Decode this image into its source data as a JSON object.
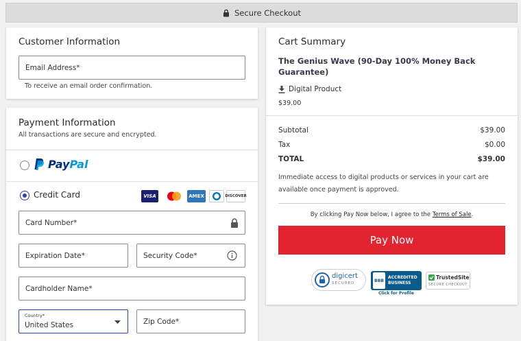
{
  "topbar": {
    "title": "Secure Checkout"
  },
  "customer": {
    "title": "Customer Information",
    "email_label": "Email Address*",
    "email_hint": "To receive an email order confirmation."
  },
  "payment": {
    "title": "Payment Information",
    "subtitle": "All transactions are secure and encrypted.",
    "paypal_pay": "Pay",
    "paypal_pal": "Pal",
    "credit_card_label": "Credit Card",
    "card_brands": [
      "VISA",
      "MC",
      "AMEX",
      "DINERS",
      "DISCOVER"
    ],
    "card_number_label": "Card Number*",
    "expiration_label": "Expiration Date*",
    "security_label": "Security Code*",
    "cardholder_label": "Cardholder Name*",
    "country_label": "Country*",
    "country_value": "United States",
    "zip_label": "Zip Code*"
  },
  "cart": {
    "title": "Cart Summary",
    "product_name": "The Genius Wave (90-Day 100% Money Back Guarantee)",
    "product_type": "Digital Product",
    "product_price": "$39.00",
    "subtotal_label": "Subtotal",
    "subtotal_value": "$39.00",
    "tax_label": "Tax",
    "tax_value": "$0.00",
    "total_label": "TOTAL",
    "total_value": "$39.00",
    "access_note": "Immediate access to digital products or services in your cart are available once payment is approved.",
    "terms_prefix": "By clicking Pay Now below, I agree to the ",
    "terms_link": "Terms of Sale",
    "terms_suffix": ".",
    "pay_button": "Pay Now"
  },
  "badges": {
    "digicert": "digicert",
    "digicert_sub": "SECURED",
    "bbb_text": "ACCREDITED BUSINESS",
    "bbb_logo": "BBB",
    "bbb_link": "Click for Profile",
    "trusted": "TrustedSite",
    "trusted_sub": "SECURE CHECKOUT"
  },
  "colors": {
    "pay_button": "#e3232f",
    "radio_accent": "#2d3fc2",
    "paypal_dark": "#003087",
    "paypal_light": "#009cde"
  }
}
